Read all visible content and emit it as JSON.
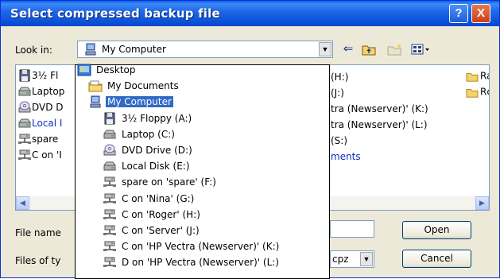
{
  "window": {
    "title": "Select compressed backup file"
  },
  "title_buttons": {
    "help": "?",
    "close": "X"
  },
  "lookin": {
    "label": "Look in:",
    "value": "My Computer"
  },
  "file_list_left": [
    "3½ Fl",
    "Laptop",
    "DVD D",
    "Local I",
    "spare",
    "C on 'I"
  ],
  "file_list_mid": [
    "(H:)",
    "(J:)",
    "tra (Newserver)' (K:)",
    "tra (Newserver)' (L:)",
    "(S:)",
    "ments"
  ],
  "file_list_right": [
    "Ra",
    "Rc"
  ],
  "filename": {
    "label": "File name",
    "value": ""
  },
  "filetype": {
    "label": "Files of ty",
    "value": "cpz"
  },
  "buttons": {
    "open": "Open",
    "cancel": "Cancel"
  },
  "dropdown": {
    "items": [
      {
        "label": "Desktop",
        "icon": "desktop-icon",
        "indent": 0,
        "selected": false
      },
      {
        "label": "My Documents",
        "icon": "folder-icon",
        "indent": 1,
        "selected": false
      },
      {
        "label": "My Computer",
        "icon": "computer-icon",
        "indent": 1,
        "selected": true
      },
      {
        "label": "3½ Floppy (A:)",
        "icon": "floppy-icon",
        "indent": 2,
        "selected": false
      },
      {
        "label": "Laptop (C:)",
        "icon": "drive-icon",
        "indent": 2,
        "selected": false
      },
      {
        "label": "DVD Drive (D:)",
        "icon": "dvd-icon",
        "indent": 2,
        "selected": false
      },
      {
        "label": "Local Disk (E:)",
        "icon": "drive-icon",
        "indent": 2,
        "selected": false
      },
      {
        "label": "spare on 'spare' (F:)",
        "icon": "network-drive-icon",
        "indent": 2,
        "selected": false
      },
      {
        "label": "C on 'Nina' (G:)",
        "icon": "network-drive-icon",
        "indent": 2,
        "selected": false
      },
      {
        "label": "C on 'Roger' (H:)",
        "icon": "network-drive-icon",
        "indent": 2,
        "selected": false
      },
      {
        "label": "C on 'Server' (J:)",
        "icon": "network-drive-icon",
        "indent": 2,
        "selected": false
      },
      {
        "label": "C on 'HP Vectra (Newserver)' (K:)",
        "icon": "network-drive-icon",
        "indent": 2,
        "selected": false
      },
      {
        "label": "D on 'HP Vectra (Newserver)' (L:)",
        "icon": "network-drive-icon",
        "indent": 2,
        "selected": false
      }
    ]
  }
}
